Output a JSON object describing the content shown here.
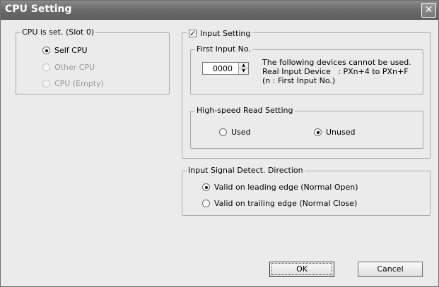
{
  "window": {
    "title": "CPU Setting",
    "close_glyph": "✕"
  },
  "cpu_group": {
    "legend": "CPU is set. (Slot 0)",
    "options": [
      {
        "label": "Self CPU",
        "checked": true,
        "enabled": true
      },
      {
        "label": "Other CPU",
        "checked": false,
        "enabled": false
      },
      {
        "label": "CPU (Empty)",
        "checked": false,
        "enabled": false
      }
    ]
  },
  "input_setting": {
    "label": "Input Setting",
    "checked": true,
    "check_glyph": "✓",
    "first_input": {
      "legend": "First Input No.",
      "value": "0000",
      "note_line1": "The following devices cannot be used.",
      "note_line2": "Real Input Device   : PXn+4 to PXn+F",
      "note_line3": "(n : First Input No.)"
    },
    "high_speed": {
      "legend": "High-speed Read Setting",
      "used_label": "Used",
      "unused_label": "Unused",
      "selected": "Unused"
    }
  },
  "signal_direction": {
    "legend": "Input Signal Detect. Direction",
    "leading_label": "Valid on leading edge (Normal Open)",
    "trailing_label": "Valid on trailing edge (Normal Close)",
    "selected": "leading"
  },
  "buttons": {
    "ok": "OK",
    "cancel": "Cancel"
  }
}
